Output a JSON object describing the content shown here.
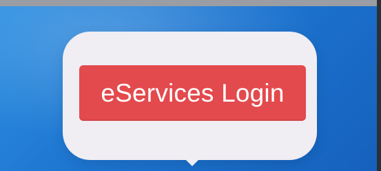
{
  "login_button": {
    "label": "eServices Login",
    "color": "#e34a4d",
    "text_color": "#ffffff"
  },
  "speech_bubble": {
    "color": "#f0edf3"
  },
  "background": {
    "color": "#1d75d0"
  }
}
